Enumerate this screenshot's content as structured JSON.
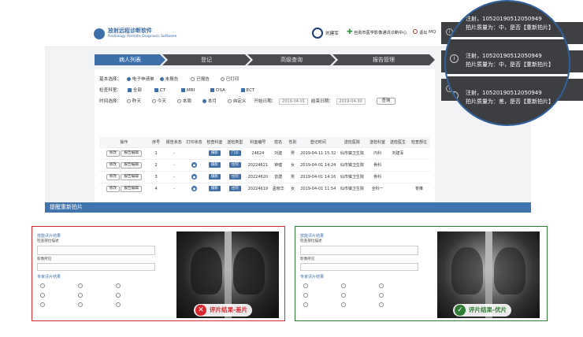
{
  "app": {
    "name": "放射远程诊断软件",
    "subtitle": "Radiology Remote Diagnosis Software",
    "user": "刘建军",
    "hospital": "自贡市医学影像通讯诊断中心",
    "logout": "退出",
    "mq": "MQ"
  },
  "nav": {
    "tabs": [
      "病人列表",
      "登记",
      "高级查询",
      "报告管理"
    ]
  },
  "filters": {
    "basic_label": "基本选择：",
    "basic_options": [
      "电子申请单",
      "未报告",
      "已报告",
      "已打印"
    ],
    "modality_label": "检查科室：",
    "modality_options": [
      "全部",
      "CT",
      "MRI",
      "DSA",
      "ECT"
    ],
    "time_label": "时间选择：",
    "time_options": [
      "昨天",
      "今天",
      "本周",
      "本月",
      "自定义"
    ],
    "start_label": "开始日期：",
    "start_value": "2019-04-01",
    "end_label": "结束日期：",
    "end_value": "2019-04-30",
    "query_button": "查询"
  },
  "table": {
    "columns": [
      "操作",
      "序号",
      "报告状态",
      "打印状态",
      "检查科室",
      "送检类型",
      "科室编号",
      "姓名",
      "性别",
      "登记时间",
      "送检医院",
      "送检科室",
      "送检医生",
      "检查部位"
    ],
    "view_label": "修改",
    "report_label": "报告编辑",
    "rows": [
      {
        "no": "1",
        "status": "-",
        "modality": "摄影",
        "type": "门诊",
        "id": "24624",
        "name": "刘建",
        "sex": "男",
        "time": "2019-04-11 15:32",
        "hosp": "仙市镇卫生院",
        "dept": "内科",
        "doc": "刘建军",
        "part": ""
      },
      {
        "no": "2",
        "status": "-",
        "modality": "摄影",
        "type": "住院",
        "id": "20224621",
        "name": "钟健",
        "sex": "女",
        "time": "2019-04-01 14:24",
        "hosp": "仙市镇卫生院",
        "dept": "骨科",
        "doc": "",
        "part": ""
      },
      {
        "no": "3",
        "status": "-",
        "modality": "摄影",
        "type": "住院",
        "id": "20224620",
        "name": "曾建",
        "sex": "男",
        "time": "2019-04-01 14:16",
        "hosp": "仙市镇卫生院",
        "dept": "骨科",
        "doc": "",
        "part": ""
      },
      {
        "no": "4",
        "status": "-",
        "modality": "摄影",
        "type": "住院",
        "id": "20224619",
        "name": "孟晓华",
        "sex": "女",
        "time": "2019-04-01 11:54",
        "hosp": "仙市镇卫生院",
        "dept": "全科一",
        "doc": "",
        "part": "脊椎"
      }
    ]
  },
  "notifications": [
    {
      "title": "注射，10520190512050949",
      "line": "拍片质量为：中，是否【重新拍片】",
      "link": "重新拍片"
    },
    {
      "title": "注射，10520190512050949",
      "line": "拍片质量为：中，是否【重新拍片】",
      "link": "重新拍片"
    },
    {
      "title": "注射，10520190512050949",
      "line": "拍片质量为：差，是否【重新拍片】",
      "link": "重新拍片"
    }
  ],
  "banner": "提醒重新拍片",
  "compare": [
    {
      "result": "评片结果-差片",
      "color": "#d9272e",
      "icon": "✕"
    },
    {
      "result": "评片结果-优片",
      "color": "#2e7d32",
      "icon": "✓"
    }
  ],
  "form_labels": {
    "section1": "技能评片结果",
    "section2": "专家评片结果",
    "field1": "检查部位描述",
    "field2": "影像所见"
  },
  "colors": {
    "primary": "#3d6fa8",
    "nav_dark": "#4a4c4f",
    "bad": "#d9272e",
    "good": "#2e7d32"
  }
}
